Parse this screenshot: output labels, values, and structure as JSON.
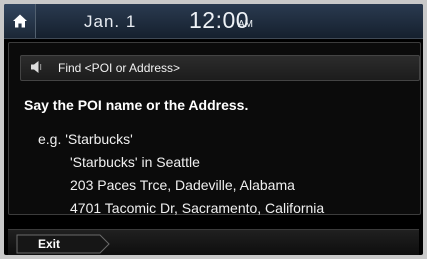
{
  "status_bar": {
    "home_icon": "home-icon",
    "date": "Jan.  1",
    "time": "12:00",
    "ampm": "AM"
  },
  "panel": {
    "speaker_icon": "speaker-icon",
    "find_label": "Find <POI or Address>",
    "instruction": "Say the POI name or the Address.",
    "examples": [
      "e.g. 'Starbucks'",
      "'Starbucks' in Seattle",
      "203 Paces Trce, Dadeville, Alabama",
      "4701 Tacomic Dr, Sacramento, California"
    ]
  },
  "footer": {
    "exit_label": "Exit"
  }
}
